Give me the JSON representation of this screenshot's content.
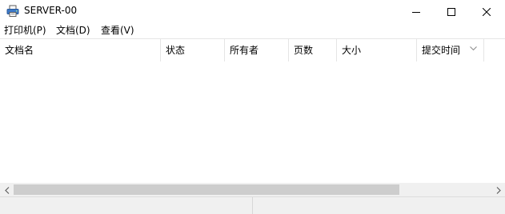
{
  "window": {
    "title": "SERVER-00",
    "app_icon": "printer-icon",
    "controls": {
      "minimize": "minimize-icon",
      "maximize": "maximize-icon",
      "close": "close-icon"
    }
  },
  "menu": {
    "items": [
      {
        "label": "打印机(P)"
      },
      {
        "label": "文档(D)"
      },
      {
        "label": "查看(V)"
      }
    ]
  },
  "list": {
    "columns": [
      {
        "label": "文档名"
      },
      {
        "label": "状态"
      },
      {
        "label": "所有者"
      },
      {
        "label": "页数"
      },
      {
        "label": "大小"
      },
      {
        "label": "提交时间"
      }
    ],
    "sort_icon": "chevron-down-icon",
    "rows": []
  },
  "scrollbar": {
    "left_icon": "scroll-left-icon",
    "right_icon": "scroll-right-icon"
  },
  "status": {
    "pane1": "",
    "pane2": ""
  },
  "colors": {
    "background": "#ffffff",
    "chrome": "#f0f0f0",
    "divider": "#e5e5e5",
    "scroll_thumb": "#cdcdcd"
  }
}
